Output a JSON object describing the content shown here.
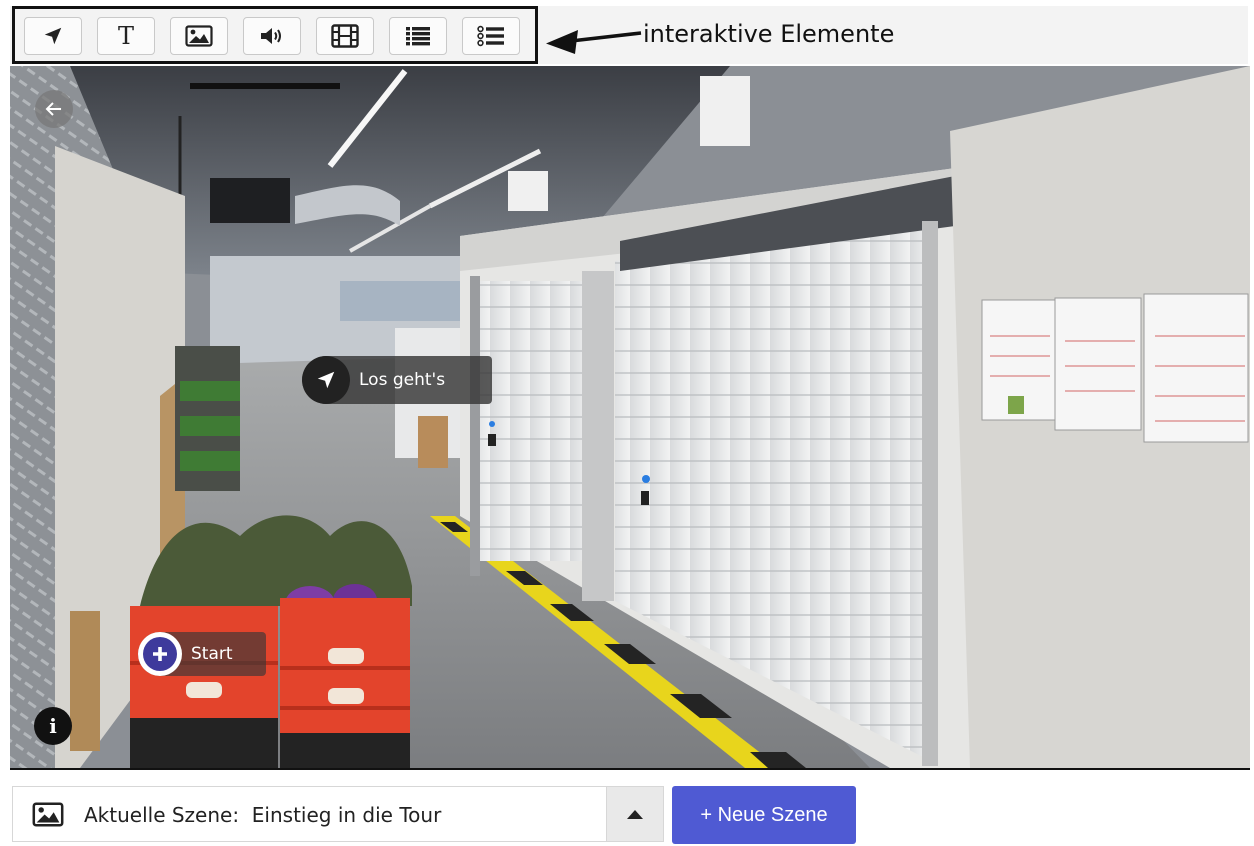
{
  "toolbar": {
    "buttons": [
      {
        "icon": "navigation-arrow-icon"
      },
      {
        "icon": "text-icon",
        "glyph": "T"
      },
      {
        "icon": "image-icon"
      },
      {
        "icon": "audio-icon"
      },
      {
        "icon": "video-icon"
      },
      {
        "icon": "list-icon"
      },
      {
        "icon": "numbered-list-icon"
      }
    ],
    "callout_label": "interaktive Elemente"
  },
  "scene": {
    "hotspots": [
      {
        "type": "navigation",
        "label": "Los geht's"
      },
      {
        "type": "start",
        "label": "Start"
      }
    ],
    "info_glyph": "i"
  },
  "bottom": {
    "scene_prefix": "Aktuelle Szene:",
    "scene_name": "Einstieg in die Tour",
    "new_scene_label": "+ Neue Szene"
  },
  "colors": {
    "accent": "#4f5ad3",
    "hotspot_start": "#3e3a9c",
    "hazard_yellow": "#e8d51c"
  }
}
